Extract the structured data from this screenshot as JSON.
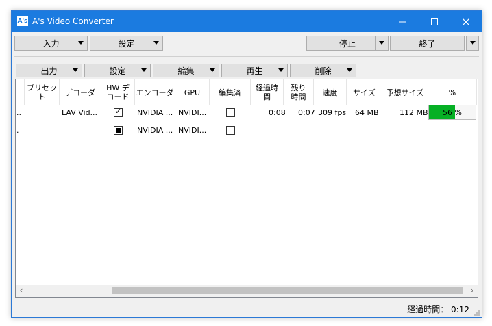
{
  "window": {
    "title": "A's Video Converter",
    "app_icon": "A's"
  },
  "toolbar": {
    "input_label": "入力",
    "settings_label": "設定",
    "stop_label": "停止",
    "exit_label": "終了"
  },
  "queue_toolbar": {
    "output_label": "出力",
    "settings_label": "設定",
    "edit_label": "編集",
    "play_label": "再生",
    "delete_label": "削除"
  },
  "columns": [
    "プリセット",
    "デコーダ",
    "HWデコード",
    "エンコーダ",
    "GPU",
    "編集済",
    "経過時間",
    "残り時間",
    "速度",
    "サイズ",
    "予想サイズ",
    "%"
  ],
  "column_display": {
    "preset": "プリセッ\nト",
    "decoder": "デコーダ",
    "hw": "HW デ\nコード",
    "encoder": "エンコーダ",
    "gpu": "GPU",
    "edited": "編集済",
    "elapsed": "経過時\n間",
    "remaining": "残り\n時間",
    "speed": "速度",
    "size": "サイズ",
    "est_size": "予想サイズ",
    "pct": "%"
  },
  "rows": [
    {
      "lead": "..",
      "decoder": "LAV Vid...",
      "hw_decode": "checked",
      "encoder": "NVIDIA ...",
      "gpu": "NVIDI...",
      "edited": false,
      "elapsed": "0:08",
      "remaining": "0:07",
      "speed": "309 fps",
      "size": "64 MB",
      "est_size": "112 MB",
      "progress_text": "56 %",
      "progress": 56
    },
    {
      "lead": ".",
      "decoder": "",
      "hw_decode": "indeterminate",
      "encoder": "NVIDIA ...",
      "gpu": "NVIDI...",
      "edited": false,
      "elapsed": "",
      "remaining": "",
      "speed": "",
      "size": "",
      "est_size": "",
      "progress_text": "",
      "progress": null
    }
  ],
  "status": {
    "elapsed_label": "経過時間： 0:12"
  },
  "colors": {
    "titlebar": "#1b7be0",
    "progress": "#06b025"
  },
  "icons": [
    "minimize-icon",
    "maximize-icon",
    "close-icon",
    "chevron-down-icon",
    "scroll-left-icon",
    "scroll-right-icon"
  ]
}
